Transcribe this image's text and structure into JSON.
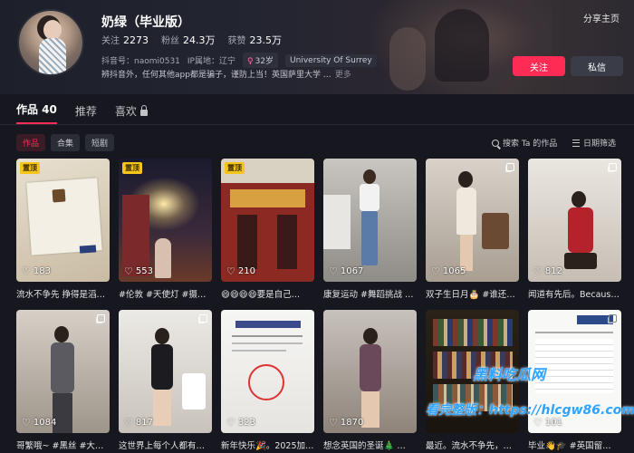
{
  "profile": {
    "name": "奶绿（毕业版）",
    "stats": [
      {
        "label": "关注",
        "value": "2273"
      },
      {
        "label": "粉丝",
        "value": "24.3万"
      },
      {
        "label": "获赞",
        "value": "23.5万"
      }
    ],
    "douyin_id": "抖音号：naomi0531",
    "ip_location": "IP属地：辽宁",
    "age_tag": "32岁",
    "school_tag": "University Of Surrey",
    "bio": "brapprox. “辨抖音外，任何其他app都是骗子，谨防上当！英国萨里大学…”",
    "bio_text": "辨抖音外，任何其他app都是骗子，谨防上当！英国萨里大学 …",
    "more": "更多",
    "share_home": "分享主页",
    "follow_button": "关注",
    "message_button": "私信"
  },
  "tabs": [
    {
      "label": "作品 40",
      "active": true
    },
    {
      "label": "推荐",
      "active": false
    },
    {
      "label": "喜欢",
      "active": false
    }
  ],
  "filters": [
    {
      "label": "作品",
      "active": true
    },
    {
      "label": "合集",
      "active": false
    },
    {
      "label": "短剧",
      "active": false
    }
  ],
  "search_label": "搜索 Ta 的作品",
  "sort_label": "日期筛选",
  "pin_label": "置顶",
  "videos": [
    {
      "likes": "183",
      "caption": "流水不争先 挣得是滔…",
      "pinned": true,
      "multi": false
    },
    {
      "likes": "553",
      "caption": "#伦敦 #天使灯 #摄政…",
      "pinned": true,
      "multi": false
    },
    {
      "likes": "210",
      "caption": "😄😄😄😄要是自己…",
      "pinned": true,
      "multi": false
    },
    {
      "likes": "1067",
      "caption": "康复运动 #舞蹈挑战 #…",
      "pinned": false,
      "multi": false
    },
    {
      "likes": "1065",
      "caption": "双子生日月🎂 #谁还…",
      "pinned": false,
      "multi": true
    },
    {
      "likes": "812",
      "caption": "闻道有先后。Because…",
      "pinned": false,
      "multi": true
    },
    {
      "likes": "1084",
      "caption": "哥繁哦~ #黑丝 #大长…",
      "pinned": false,
      "multi": true
    },
    {
      "likes": "817",
      "caption": "这世界上每个人都有病…",
      "pinned": false,
      "multi": true
    },
    {
      "likes": "323",
      "caption": "新年快乐🎉。2025加…",
      "pinned": false,
      "multi": false
    },
    {
      "likes": "1870",
      "caption": "想念英国的圣诞🎄 …",
      "pinned": false,
      "multi": false
    },
    {
      "likes": "",
      "caption": "最近。流水不争先，争…",
      "pinned": false,
      "multi": false
    },
    {
      "likes": "101",
      "caption": "毕业👋🎓 #英国留…",
      "pinned": false,
      "multi": true
    }
  ],
  "watermark": {
    "line1": "黑料吃瓜网",
    "line2": "看完整版：https://hlcgw86.com"
  },
  "colors": {
    "accent": "#fe2c55",
    "background": "#16171f"
  }
}
